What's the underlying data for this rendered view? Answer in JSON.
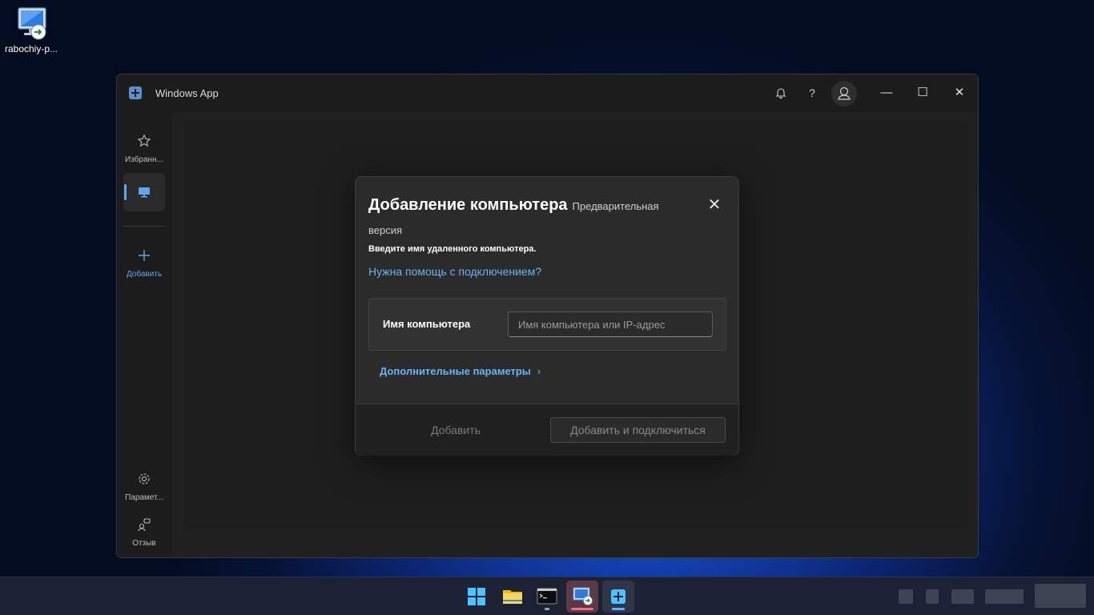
{
  "desktop": {
    "icon_label": "rabochiy-p..."
  },
  "window": {
    "title": "Windows App",
    "help_label": "?",
    "minimize_label": "—",
    "maximize_label": "☐",
    "close_label": "✕"
  },
  "sidebar": {
    "items": [
      {
        "label": "Избранн...",
        "icon": "star-icon"
      },
      {
        "label": "",
        "icon": "monitor-icon"
      },
      {
        "label": "Добавить",
        "icon": "plus-icon"
      },
      {
        "label": "Парамет...",
        "icon": "gear-icon"
      },
      {
        "label": "Отзыв",
        "icon": "feedback-icon"
      }
    ]
  },
  "dialog": {
    "title": "Добавление компьютера",
    "badge": "Предварительная версия",
    "close_label": "✕",
    "description": "Введите имя удаленного компьютера.",
    "help_link": "Нужна помощь с подключением?",
    "field_label": "Имя компьютера",
    "field_value": "",
    "field_placeholder": "Имя компьютера или IP-адрес",
    "advanced": "Дополнительные параметры",
    "advanced_chevron": "›",
    "btn_add": "Добавить",
    "btn_add_connect": "Добавить и подключиться"
  },
  "taskbar": {
    "apps": [
      "windows-start-icon",
      "file-explorer-icon",
      "terminal-icon",
      "remote-desktop-icon",
      "windows-app-icon"
    ],
    "active_app": "windows-app-icon"
  },
  "colors": {
    "accent_link": "#6ab4f5",
    "dialog_bg": "#2b2b2b",
    "window_bg": "#1c1c1c"
  }
}
